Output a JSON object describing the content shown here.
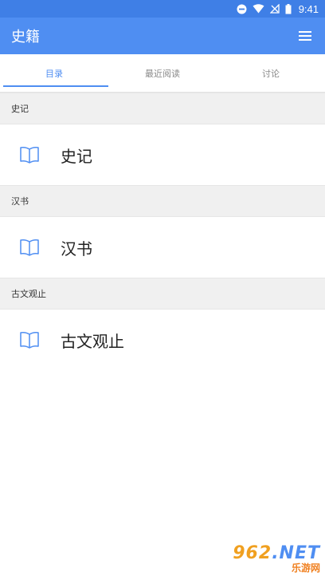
{
  "status_bar": {
    "time": "9:41"
  },
  "app_bar": {
    "title": "史籍"
  },
  "tabs": [
    {
      "label": "目录",
      "active": true
    },
    {
      "label": "最近阅读",
      "active": false
    },
    {
      "label": "讨论",
      "active": false
    }
  ],
  "sections": [
    {
      "header": "史记",
      "item": "史记"
    },
    {
      "header": "汉书",
      "item": "汉书"
    },
    {
      "header": "古文观止",
      "item": "古文观止"
    }
  ],
  "watermark": {
    "top_num": "962",
    "top_suffix": ".NET",
    "bottom": "乐游网"
  },
  "colors": {
    "accent": "#4f8ef2",
    "status_bar": "#3f7fe6"
  }
}
